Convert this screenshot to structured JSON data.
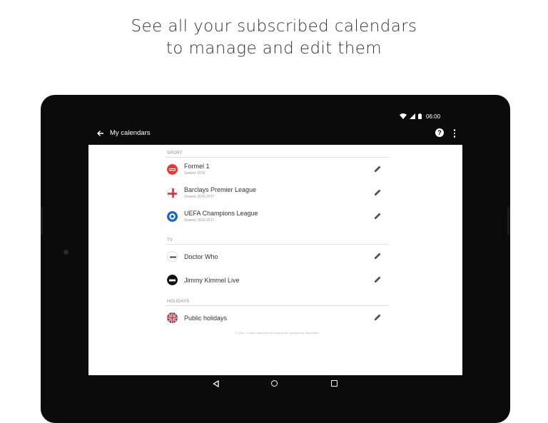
{
  "headline": {
    "line1": "See all your subscribed calendars",
    "line2": "to manage and edit them"
  },
  "statusbar": {
    "time": "06:00",
    "icons": [
      "wifi-icon",
      "cellular-icon",
      "battery-icon"
    ]
  },
  "appbar": {
    "title": "My calendars",
    "help_glyph": "?",
    "icons": [
      "back-arrow-icon",
      "help-icon",
      "more-vert-icon"
    ]
  },
  "sections": [
    {
      "label": "SPORT",
      "items": [
        {
          "name": "Formel 1",
          "subtitle": "Season 2016",
          "icon": "formel1-logo-icon"
        },
        {
          "name": "Barclays Premier League",
          "subtitle": "Season 2016-2017",
          "icon": "england-flag-icon"
        },
        {
          "name": "UEFA Champions League",
          "subtitle": "Season 2016-2017",
          "icon": "champions-league-logo-icon"
        }
      ]
    },
    {
      "label": "TV",
      "items": [
        {
          "name": "Doctor Who",
          "subtitle": "",
          "icon": "doctor-who-logo-icon"
        },
        {
          "name": "Jimmy Kimmel Live",
          "subtitle": "",
          "icon": "abc-logo-icon"
        }
      ]
    },
    {
      "label": "HOLIDAYS",
      "items": [
        {
          "name": "Public holidays",
          "subtitle": "",
          "icon": "uk-flag-icon"
        }
      ]
    }
  ],
  "footer_note": "© 2016. Content calendars and events are provided by 3rd parties.",
  "colors": {
    "tablet_bezel": "#0b0b0b",
    "screen_bg": "#ffffff",
    "primary_text": "#333333",
    "secondary_text": "#999999",
    "formel1_red": "#e53935",
    "cl_blue": "#1565c0"
  },
  "navbar": {
    "icons": [
      "nav-back-icon",
      "nav-home-icon",
      "nav-recents-icon"
    ]
  }
}
